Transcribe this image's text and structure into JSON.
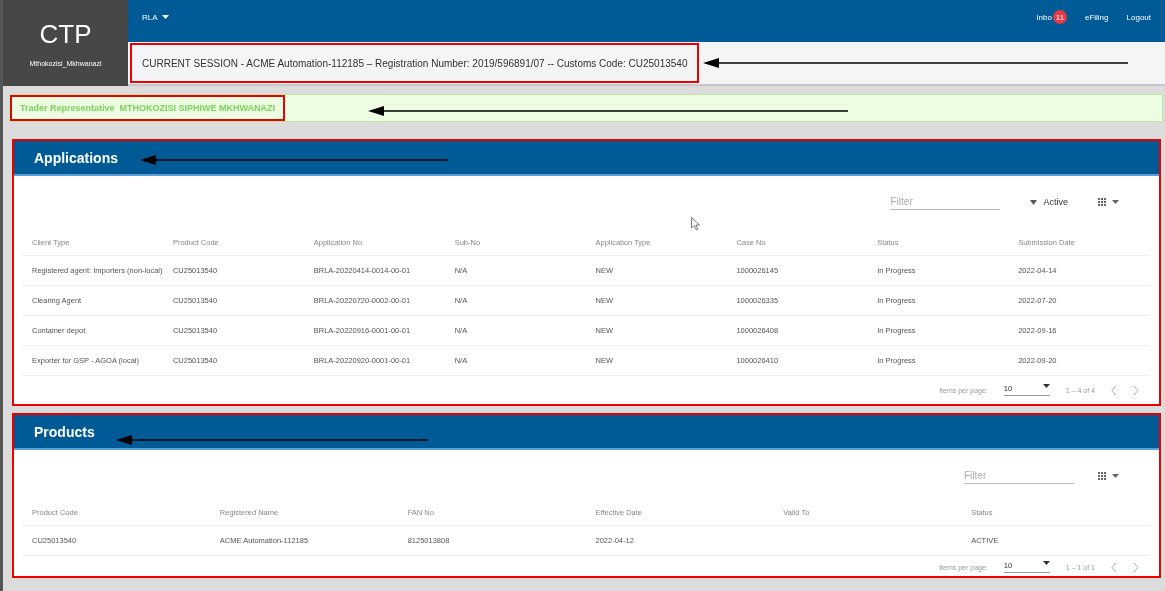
{
  "brand": {
    "logo": "CTP",
    "username": "Mthokozisi_Mkhwanazi"
  },
  "topbar": {
    "menu": "RLA",
    "links": [
      {
        "kind": "inbox",
        "label": "Inbo",
        "badge": "11"
      },
      {
        "kind": "link",
        "label": "eFiling"
      },
      {
        "kind": "link",
        "label": "Logout"
      }
    ]
  },
  "session": "CURRENT SESSION - ACME Automation-112185 – Registration Number: 2019/596891/07 -- Customs Code: CU25013540",
  "trader": {
    "label": "Trader Representative",
    "name": "MTHOKOZISI SIPHIWE MKHWANAZI"
  },
  "applications": {
    "title": "Applications",
    "filter": {
      "placeholder": "Filter"
    },
    "status_filter": "Active",
    "columns": [
      "Client Type",
      "Product Code",
      "Application No",
      "Sub-No",
      "Application Type",
      "Case No",
      "Status",
      "Submission Date"
    ],
    "rows": [
      [
        "Registered agent: Importers (non-local)",
        "CU25013540",
        "BRLA-20220414-0014-00-01",
        "N/A",
        "NEW",
        "1000026145",
        "In Progress",
        "2022-04-14"
      ],
      [
        "Clearing Agent",
        "CU25013540",
        "BRLA-20220720-0002-00-01",
        "N/A",
        "NEW",
        "1000026335",
        "In Progress",
        "2022-07-20"
      ],
      [
        "Container depot",
        "CU25013540",
        "BRLA-20220916-0001-00-01",
        "N/A",
        "NEW",
        "1000026408",
        "In Progress",
        "2022-09-16"
      ],
      [
        "Exporter for GSP - AGOA (local)",
        "CU25013540",
        "BRLA-20220920-0001-00-01",
        "N/A",
        "NEW",
        "1000026410",
        "In Progress",
        "2022-09-20"
      ]
    ],
    "paginator": {
      "label": "Items per page:",
      "page_size": "10",
      "range": "1 – 4 of 4"
    }
  },
  "products": {
    "title": "Products",
    "filter": {
      "placeholder": "Filter"
    },
    "columns": [
      "Product Code",
      "Registered Name",
      "FAN No",
      "Effective Date",
      "Valid To",
      "Status"
    ],
    "rows": [
      [
        "CU25013540",
        "ACME Automation-112185",
        "8125013808",
        "2022-04-12",
        "",
        "ACTIVE"
      ]
    ],
    "paginator": {
      "label": "Items per page:",
      "page_size": "10",
      "range": "1 – 1 of 1"
    }
  }
}
